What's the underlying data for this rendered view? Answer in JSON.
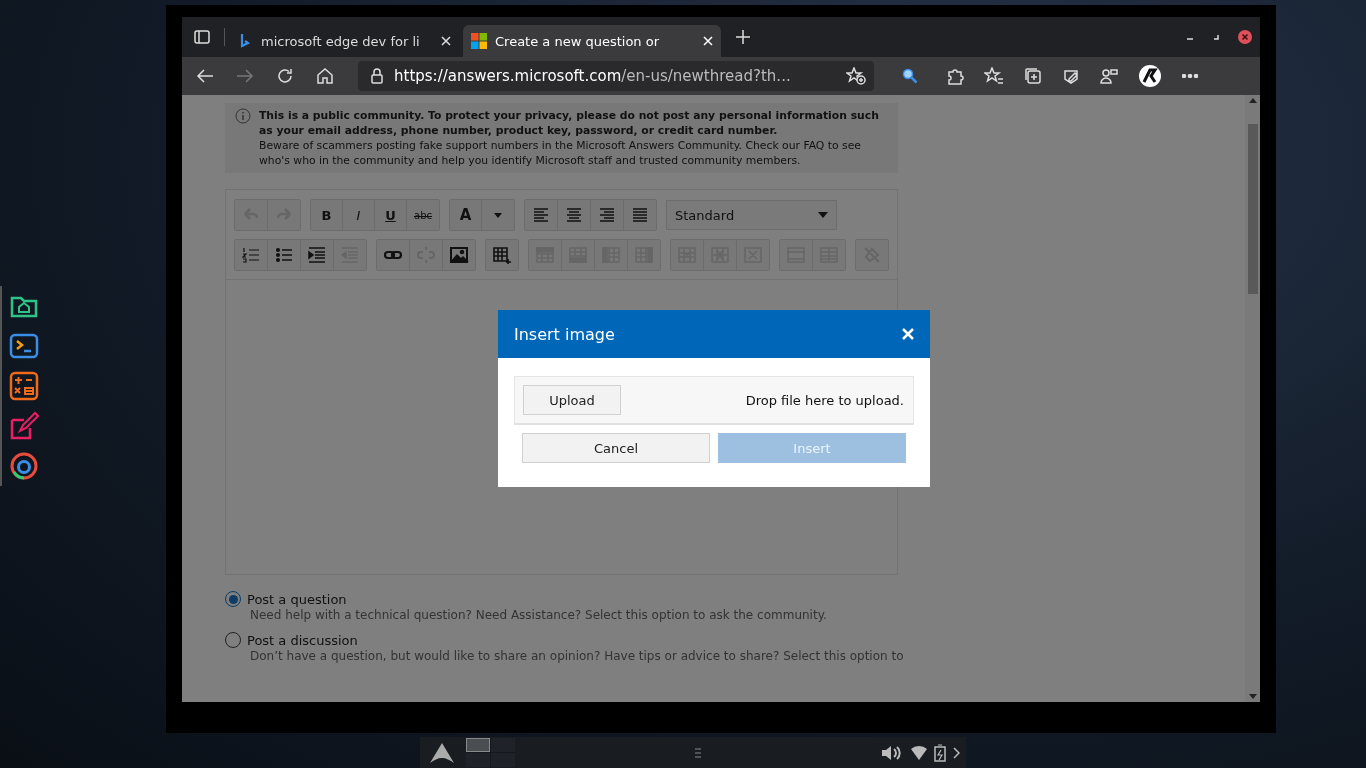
{
  "tabs": [
    {
      "label": "microsoft edge dev for li",
      "selected": false
    },
    {
      "label": "Create a new question or",
      "selected": true
    }
  ],
  "address_bar": {
    "host": "https://answers.microsoft.com",
    "path": "/en-us/newthread?th..."
  },
  "notice": {
    "warning": "This is a public community. To protect your privacy, please do not post any personal information such as your email address, phone number, product key, password, or credit card number.",
    "text": "Beware of scammers posting fake support numbers in the Microsoft Answers Community.  Check our FAQ to see who's who in the community and help you identify Microsoft staff and trusted community members."
  },
  "editor": {
    "toolbar_rows": [
      [
        [
          {
            "kind": "undo",
            "disabled": true
          },
          {
            "kind": "redo",
            "disabled": true
          }
        ],
        [
          {
            "kind": "bold",
            "label": "B",
            "disabled": false
          },
          {
            "kind": "italic",
            "label": "I",
            "disabled": false
          },
          {
            "kind": "underline",
            "label": "U",
            "disabled": false
          },
          {
            "kind": "strike",
            "label": "abc",
            "disabled": false
          }
        ],
        [
          {
            "kind": "font-color",
            "label": "A",
            "disabled": false
          },
          {
            "kind": "caret",
            "disabled": false
          }
        ],
        [
          {
            "kind": "align-left",
            "disabled": false
          },
          {
            "kind": "align-center",
            "disabled": false
          },
          {
            "kind": "align-right",
            "disabled": false
          },
          {
            "kind": "justify",
            "disabled": false
          }
        ]
      ],
      [
        [
          {
            "kind": "ordered-list",
            "disabled": false
          },
          {
            "kind": "bullet-list",
            "disabled": false
          },
          {
            "kind": "indent",
            "disabled": false
          },
          {
            "kind": "outdent",
            "disabled": true
          }
        ],
        [
          {
            "kind": "link",
            "disabled": false
          },
          {
            "kind": "unlink",
            "disabled": true
          },
          {
            "kind": "image",
            "disabled": false
          }
        ],
        [
          {
            "kind": "table",
            "disabled": false
          }
        ],
        [
          {
            "kind": "row-above",
            "disabled": true
          },
          {
            "kind": "row-below",
            "disabled": true
          },
          {
            "kind": "col-left",
            "disabled": true
          },
          {
            "kind": "col-right",
            "disabled": true
          }
        ],
        [
          {
            "kind": "delete-row",
            "disabled": true
          },
          {
            "kind": "delete-col",
            "disabled": true
          },
          {
            "kind": "delete-cell",
            "disabled": true
          }
        ],
        [
          {
            "kind": "cell-props",
            "disabled": true
          },
          {
            "kind": "table-props",
            "disabled": true
          }
        ],
        [
          {
            "kind": "delete-table",
            "disabled": true
          }
        ]
      ]
    ],
    "block_format": "Standard"
  },
  "dialog": {
    "title": "Insert image",
    "upload_button": "Upload",
    "drop_hint": "Drop file here to upload.",
    "cancel_button": "Cancel",
    "insert_button": {
      "label": "Insert",
      "disabled": true
    }
  },
  "post_types": [
    {
      "label": "Post a question",
      "description": "Need help with a technical question? Need Assistance? Select this option to ask the community.",
      "selected": true
    },
    {
      "label": "Post a discussion",
      "description": "Don’t have a question, but would like to share an opinion? Have tips or advice to share? Select this option to",
      "selected": false
    }
  ]
}
